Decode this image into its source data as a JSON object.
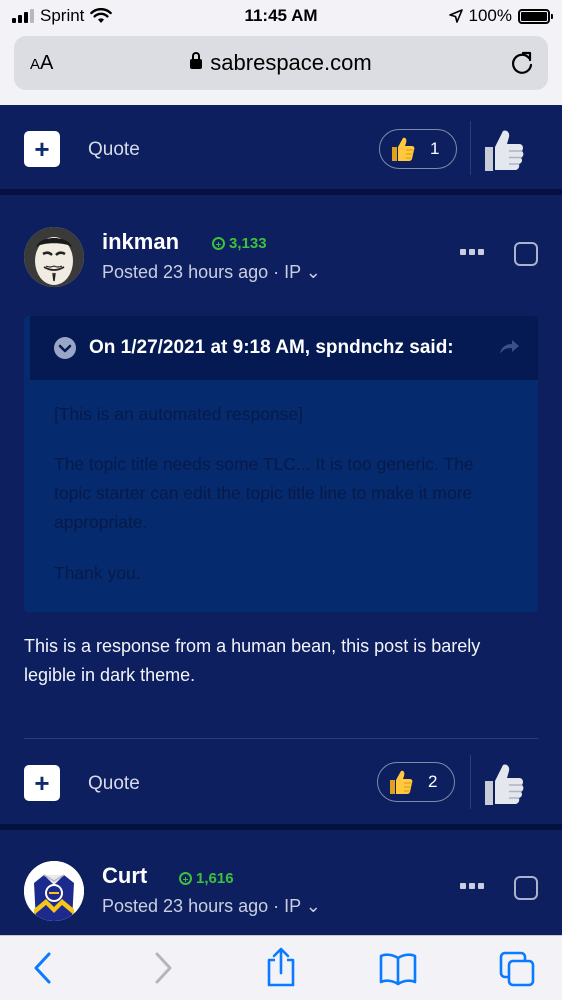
{
  "status": {
    "carrier": "Sprint",
    "time": "11:45 AM",
    "battery": "100%"
  },
  "browser": {
    "aa_label_small": "A",
    "aa_label_big": "A",
    "url": "sabrespace.com"
  },
  "top_actions": {
    "quote_label": "Quote",
    "like_count": "1"
  },
  "post": {
    "username": "inkman",
    "reputation": "3,133",
    "posted": "Posted 23 hours ago · IP ⌄",
    "quote": {
      "header": "On 1/27/2021 at 9:18 AM, spndnchz said:",
      "lines": [
        "[This is an automated response]",
        "The topic title needs some TLC... It is too generic. The topic starter can edit the topic title line to make it more appropriate.",
        "Thank you."
      ]
    },
    "body": "This is a response from a human bean, this post is barely legible in dark theme.",
    "quote_label": "Quote",
    "like_count": "2"
  },
  "next_post": {
    "username": "Curt",
    "reputation": "1,616",
    "posted": "Posted 23 hours ago · IP ⌄"
  },
  "colors": {
    "background": "#0d1f5e",
    "quote_bg": "#062a6e",
    "reputation_green": "#3cc13c",
    "ios_blue": "#0a7aff"
  }
}
